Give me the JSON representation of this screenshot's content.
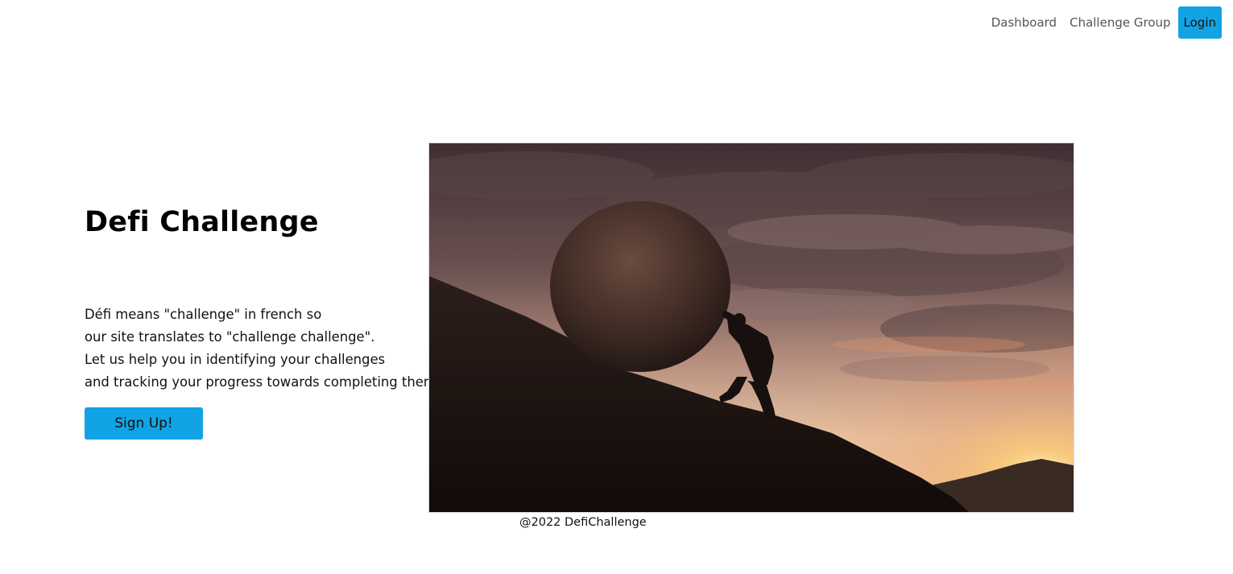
{
  "nav": {
    "items": [
      {
        "label": "Dashboard"
      },
      {
        "label": "Challenge Group"
      }
    ],
    "login_label": "Login"
  },
  "hero": {
    "title": "Defi Challenge",
    "description_lines": [
      "Défi means \"challenge\" in french so",
      "our site translates to \"challenge challenge\".",
      "Let us help you in identifying your challenges",
      "and tracking your progress towards completing them."
    ],
    "signup_label": "Sign Up!",
    "image_subject": "man-pushing-boulder-uphill-at-sunset"
  },
  "footer": {
    "text": "@2022 DefiChallenge"
  },
  "colors": {
    "accent": "#12a3e4",
    "nav_text": "#555555",
    "text": "#111111"
  }
}
